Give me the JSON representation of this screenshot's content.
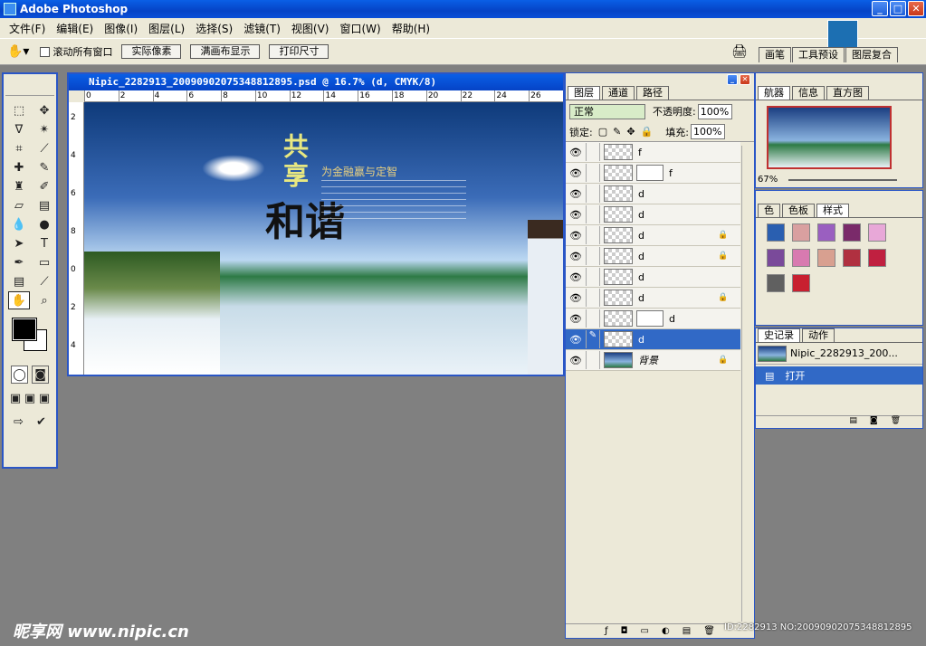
{
  "app": {
    "title": "Adobe Photoshop"
  },
  "menu": [
    "文件(F)",
    "编辑(E)",
    "图像(I)",
    "图层(L)",
    "选择(S)",
    "滤镜(T)",
    "视图(V)",
    "窗口(W)",
    "帮助(H)"
  ],
  "options": {
    "scroll_all": "滚动所有窗口",
    "buttons": [
      "实际像素",
      "满画布显示",
      "打印尺寸"
    ]
  },
  "palette_well": [
    "画笔",
    "工具预设",
    "图层复合"
  ],
  "document": {
    "title": "Nipic_2282913_20090902075348812895.psd @ 16.7% (d, CMYK/8)",
    "ruler_h": [
      "0",
      "2",
      "4",
      "6",
      "8",
      "10",
      "12",
      "14",
      "16",
      "18",
      "20",
      "22",
      "24",
      "26"
    ],
    "ruler_v": [
      "2",
      "4",
      "6",
      "8",
      "0",
      "2",
      "4"
    ],
    "artwork": {
      "heading_1": "共享",
      "heading_2": "和谐",
      "slogan": "为金融赢与定智"
    }
  },
  "layers_panel": {
    "tabs": [
      "图层",
      "通道",
      "路径"
    ],
    "blend_mode": "正常",
    "opacity_label": "不透明度:",
    "opacity": "100%",
    "lock_label": "锁定:",
    "fill_label": "填充:",
    "fill": "100%",
    "layers": [
      {
        "name": "f",
        "mask": false,
        "locked": false,
        "selected": false,
        "bg": false
      },
      {
        "name": "f",
        "mask": true,
        "locked": false,
        "selected": false,
        "bg": false
      },
      {
        "name": "d",
        "mask": false,
        "locked": false,
        "selected": false,
        "bg": false
      },
      {
        "name": "d",
        "mask": false,
        "locked": false,
        "selected": false,
        "bg": false
      },
      {
        "name": "d",
        "mask": false,
        "locked": true,
        "selected": false,
        "bg": false
      },
      {
        "name": "d",
        "mask": false,
        "locked": true,
        "selected": false,
        "bg": false
      },
      {
        "name": "d",
        "mask": false,
        "locked": false,
        "selected": false,
        "bg": false
      },
      {
        "name": "d",
        "mask": false,
        "locked": true,
        "selected": false,
        "bg": false
      },
      {
        "name": "d",
        "mask": true,
        "locked": false,
        "selected": false,
        "bg": false
      },
      {
        "name": "d",
        "mask": false,
        "locked": false,
        "selected": true,
        "bg": false
      },
      {
        "name": "背景",
        "mask": false,
        "locked": true,
        "selected": false,
        "bg": true
      }
    ]
  },
  "navigator": {
    "tabs": [
      "航器",
      "信息",
      "直方图"
    ],
    "zoom": "67%"
  },
  "swatches": {
    "tabs": [
      "色",
      "色板",
      "样式"
    ],
    "colors": [
      "#2a5fb0",
      "#d9a0a0",
      "#9a5fc0",
      "#7a2a6a",
      "#e8a8d8",
      "#7a4a9a",
      "#d87ab0",
      "#d8a090",
      "#b03040",
      "#c02040",
      "#606060",
      "#c82030"
    ]
  },
  "history": {
    "tabs": [
      "史记录",
      "动作"
    ],
    "snapshot": "Nipic_2282913_200...",
    "step": "打开"
  },
  "watermark": {
    "text": "昵享网 www.nipic.cn",
    "id": "ID:2282913 NO:20090902075348812895"
  }
}
